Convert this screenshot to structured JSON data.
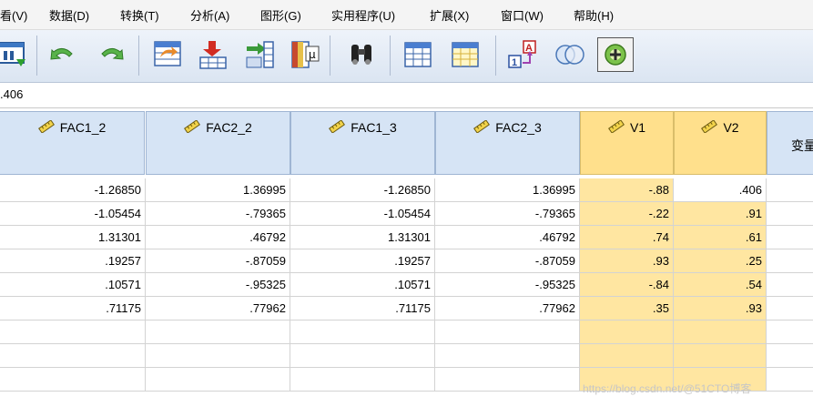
{
  "menu": [
    {
      "label": "看(V)"
    },
    {
      "label": "数据(D)"
    },
    {
      "label": "转换(T)"
    },
    {
      "label": "分析(A)"
    },
    {
      "label": "图形(G)"
    },
    {
      "label": "实用程序(U)"
    },
    {
      "label": "扩展(X)"
    },
    {
      "label": "窗口(W)"
    },
    {
      "label": "帮助(H)"
    }
  ],
  "toolbar": {
    "buttons": [
      {
        "icon": "recall-dialog-icon"
      },
      {
        "icon": "undo-icon"
      },
      {
        "icon": "redo-icon"
      },
      {
        "icon": "goto-case-icon"
      },
      {
        "icon": "insert-cases-icon"
      },
      {
        "icon": "insert-variable-icon"
      },
      {
        "icon": "variables-icon"
      },
      {
        "icon": "find-icon"
      },
      {
        "icon": "split-file-icon"
      },
      {
        "icon": "weight-cases-icon"
      },
      {
        "icon": "value-labels-icon"
      },
      {
        "icon": "use-sets-icon"
      },
      {
        "icon": "add-icon"
      }
    ]
  },
  "cell_editor": {
    "value": ".406"
  },
  "grid": {
    "columns": [
      {
        "name": "FAC1_2",
        "selected": false
      },
      {
        "name": "FAC2_2",
        "selected": false
      },
      {
        "name": "FAC1_3",
        "selected": false
      },
      {
        "name": "FAC2_3",
        "selected": false
      },
      {
        "name": "V1",
        "selected": true
      },
      {
        "name": "V2",
        "selected": true
      },
      {
        "name": "变量",
        "selected": false
      }
    ],
    "rows": [
      [
        "-1.26850",
        "1.36995",
        "-1.26850",
        "1.36995",
        "-.88",
        ".406"
      ],
      [
        "-1.05454",
        "-.79365",
        "-1.05454",
        "-.79365",
        "-.22",
        ".91"
      ],
      [
        "1.31301",
        ".46792",
        "1.31301",
        ".46792",
        ".74",
        ".61"
      ],
      [
        ".19257",
        "-.87059",
        ".19257",
        "-.87059",
        ".93",
        ".25"
      ],
      [
        ".10571",
        "-.95325",
        ".10571",
        "-.95325",
        "-.84",
        ".54"
      ],
      [
        ".71175",
        ".77962",
        ".71175",
        ".77962",
        ".35",
        ".93"
      ],
      [
        "",
        "",
        "",
        "",
        "",
        ""
      ],
      [
        "",
        "",
        "",
        "",
        "",
        ""
      ],
      [
        "",
        "",
        "",
        "",
        "",
        ""
      ]
    ],
    "active_cell_value": ".406"
  },
  "watermark": "https://blog.csdn.net/@51CTO博客",
  "colors": {
    "header": "#d6e4f5",
    "selected_header": "#ffe08c",
    "selected_cell": "#ffe6a1",
    "toolbar": "#dbe5f2"
  }
}
